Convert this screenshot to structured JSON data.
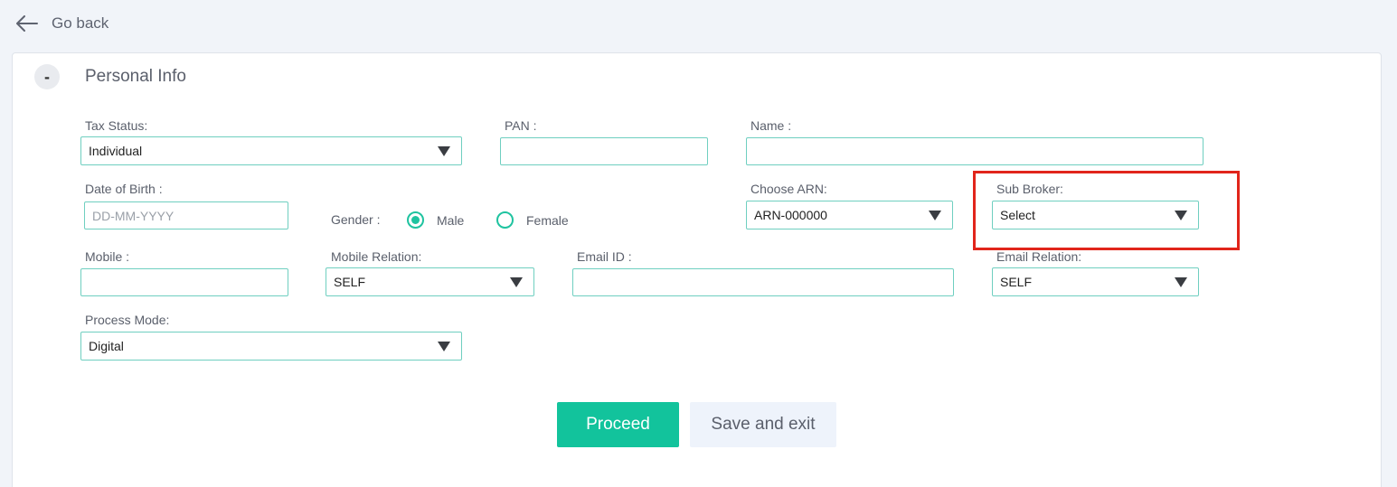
{
  "nav": {
    "back_label": "Go back",
    "back_icon": "arrow-left-icon"
  },
  "section": {
    "title": "Personal Info",
    "collapse_symbol": "-"
  },
  "form": {
    "tax_status": {
      "label": "Tax Status:",
      "value": "Individual"
    },
    "pan": {
      "label": "PAN :",
      "value": ""
    },
    "name": {
      "label": "Name :",
      "value": ""
    },
    "dob": {
      "label": "Date of Birth :",
      "placeholder": "DD-MM-YYYY",
      "value": ""
    },
    "gender": {
      "label": "Gender :",
      "options": [
        "Male",
        "Female"
      ],
      "selected": "Male"
    },
    "choose_arn": {
      "label": "Choose ARN:",
      "value": "ARN-000000"
    },
    "sub_broker": {
      "label": "Sub Broker:",
      "value": "Select"
    },
    "mobile": {
      "label": "Mobile :",
      "value": ""
    },
    "mobile_relation": {
      "label": "Mobile Relation:",
      "value": "SELF"
    },
    "email": {
      "label": "Email ID :",
      "value": ""
    },
    "email_relation": {
      "label": "Email Relation:",
      "value": "SELF"
    },
    "process_mode": {
      "label": "Process Mode:",
      "value": "Digital"
    }
  },
  "actions": {
    "proceed_label": "Proceed",
    "save_exit_label": "Save and exit"
  },
  "colors": {
    "accent": "#12c39c",
    "border": "#6fcfc0",
    "highlight": "#e1251b",
    "background": "#f1f4f9"
  }
}
